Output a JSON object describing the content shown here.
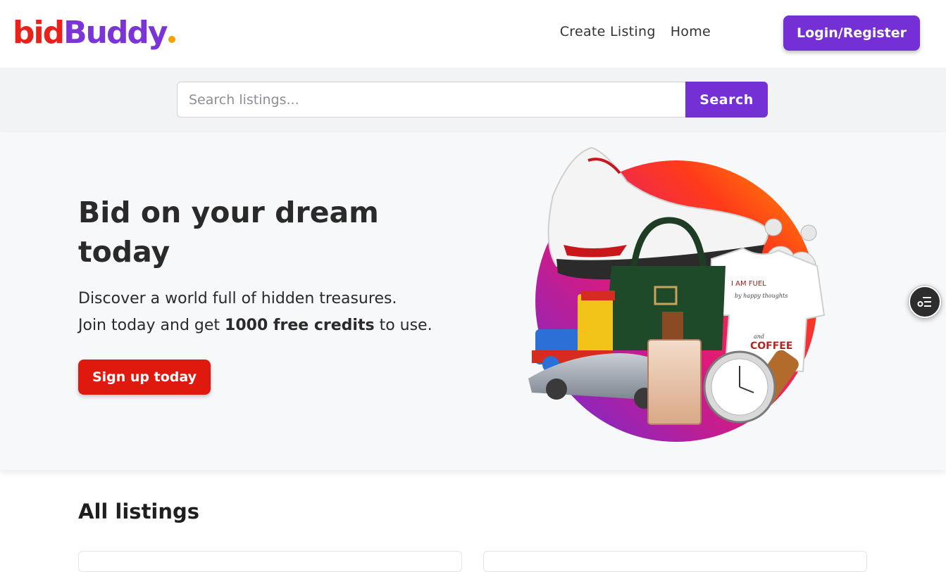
{
  "header": {
    "logo": {
      "part1": "bid",
      "part2": "Buddy"
    },
    "nav": [
      {
        "label": "Create Listing"
      },
      {
        "label": "Home"
      }
    ],
    "login_label": "Login/Register"
  },
  "search": {
    "placeholder": "Search listings...",
    "button_label": "Search"
  },
  "hero": {
    "title": "Bid on your dream today",
    "text_line1": "Discover a world full of hidden treasures.",
    "text_line2_prefix": "Join today and get ",
    "text_line2_bold": "1000 free credits",
    "text_line2_suffix": " to use.",
    "signup_label": "Sign up today",
    "illustration_items": [
      "sneaker-icon",
      "handbag-icon",
      "toy-train-icon",
      "car-icon",
      "perfume-icon",
      "watch-icon",
      "tshirt-icon",
      "pearl-earrings-icon"
    ],
    "tshirt_print": [
      "I AM FUEL",
      "by happy thoughts",
      "and",
      "COFFEE"
    ]
  },
  "listings": {
    "title": "All listings"
  },
  "colors": {
    "brand_purple": "#7430d4",
    "brand_red": "#e0190f",
    "logo_red": "#e8221b",
    "logo_purple": "#7b35d6",
    "logo_dot": "#f5a300"
  }
}
